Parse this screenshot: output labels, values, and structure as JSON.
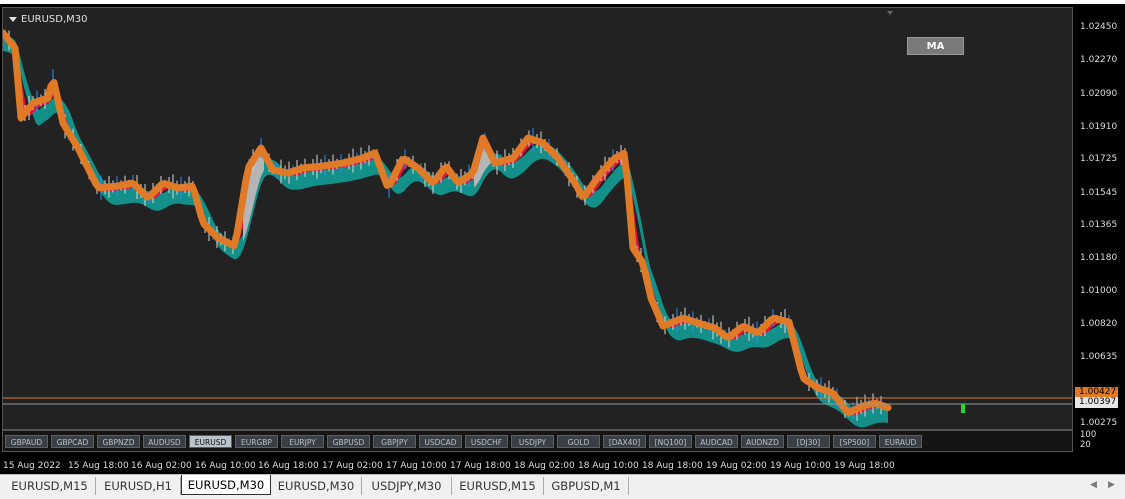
{
  "chart": {
    "symbol_title": "EURUSD,M30",
    "ma_button": "MA",
    "current_price": "1.00397",
    "upper_price": "1.00427",
    "price_scale": [
      "1.02450",
      "1.02270",
      "1.02090",
      "1.01910",
      "1.01725",
      "1.01545",
      "1.01365",
      "1.01180",
      "1.01000",
      "1.00820",
      "1.00635",
      "1.00275"
    ],
    "sub_scale": [
      "100",
      "20"
    ],
    "time_labels": [
      "15 Aug 2022",
      "15 Aug 18:00",
      "16 Aug 02:00",
      "16 Aug 10:00",
      "16 Aug 18:00",
      "17 Aug 02:00",
      "17 Aug 10:00",
      "17 Aug 18:00",
      "18 Aug 02:00",
      "18 Aug 10:00",
      "18 Aug 18:00",
      "19 Aug 02:00",
      "19 Aug 10:00",
      "19 Aug 18:00"
    ],
    "colors": {
      "background": "#222222",
      "teal": "#13908a",
      "crimson": "#e0143c",
      "orange": "#e07a26",
      "wick": "#2a8cff",
      "gray": "#b5b5b5",
      "buy_arrow": "#2bd42b"
    }
  },
  "symbol_buttons": [
    {
      "label": "GBPAUD",
      "active": false
    },
    {
      "label": "GBPCAD",
      "active": false
    },
    {
      "label": "GBPNZD",
      "active": false
    },
    {
      "label": "AUDUSD",
      "active": false
    },
    {
      "label": "EURUSD",
      "active": true
    },
    {
      "label": "EURGBP",
      "active": false
    },
    {
      "label": "EURJPY",
      "active": false
    },
    {
      "label": "GBPUSD",
      "active": false
    },
    {
      "label": "GBPJPY",
      "active": false
    },
    {
      "label": "USDCAD",
      "active": false
    },
    {
      "label": "USDCHF",
      "active": false
    },
    {
      "label": "USDJPY",
      "active": false
    },
    {
      "label": "GOLD",
      "active": false
    },
    {
      "label": "[DAX40]",
      "active": false
    },
    {
      "label": "[NQ100]",
      "active": false
    },
    {
      "label": "AUDCAD",
      "active": false
    },
    {
      "label": "AUDNZD",
      "active": false
    },
    {
      "label": "[DJ30]",
      "active": false
    },
    {
      "label": "[SP500]",
      "active": false
    },
    {
      "label": "EURAUD",
      "active": false
    }
  ],
  "tabs": [
    {
      "label": "EURUSD,M15",
      "active": false
    },
    {
      "label": "EURUSD,H1",
      "active": false
    },
    {
      "label": "EURUSD,M30",
      "active": true
    },
    {
      "label": "EURUSD,M30",
      "active": false
    },
    {
      "label": "USDJPY,M30",
      "active": false
    },
    {
      "label": "EURUSD,M15",
      "active": false
    },
    {
      "label": "GBPUSD,M1",
      "active": false
    }
  ]
}
